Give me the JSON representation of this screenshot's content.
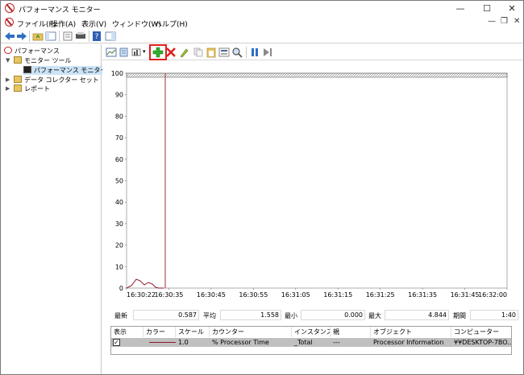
{
  "window": {
    "title": "パフォーマンス モニター",
    "minimize": "—",
    "maximize": "☐",
    "close": "✕"
  },
  "menu": {
    "items": [
      "ファイル(F)",
      "操作(A)",
      "表示(V)",
      "ウィンドウ(W)",
      "ヘルプ(H)"
    ],
    "mdi_minimize": "—",
    "mdi_restore": "❐",
    "mdi_close": "✕"
  },
  "tree": {
    "root": "パフォーマンス",
    "monitor_tools": "モニター ツール",
    "performance_monitor": "パフォーマンス モニター",
    "data_collector_sets": "データ コレクター セット",
    "reports": "レポート"
  },
  "graph": {
    "y_ticks": [
      "100",
      "90",
      "80",
      "70",
      "60",
      "50",
      "40",
      "30",
      "20",
      "10",
      "0"
    ],
    "x_ticks": [
      "16:30:22",
      "16:30:35",
      "16:30:45",
      "16:30:55",
      "16:31:05",
      "16:31:15",
      "16:31:25",
      "16:31:35",
      "16:31:45",
      "16:32:00"
    ]
  },
  "stats": {
    "last_label": "最新",
    "last_value": "0.587",
    "avg_label": "平均",
    "avg_value": "1.558",
    "min_label": "最小",
    "min_value": "0.000",
    "max_label": "最大",
    "max_value": "4.844",
    "duration_label": "期間",
    "duration_value": "1:40"
  },
  "table": {
    "headers": {
      "show": "表示",
      "color": "カラー",
      "scale": "スケール",
      "counter": "カウンター",
      "instance": "インスタンス",
      "parent": "親",
      "object": "オブジェクト",
      "computer": "コンピューター"
    },
    "row": {
      "checked": "✓",
      "scale": "1.0",
      "counter": "% Processor Time",
      "instance": "_Total",
      "parent": "---",
      "object": "Processor Information",
      "computer": "¥¥DESKTOP-7BO..."
    }
  },
  "colors": {
    "series": "#8b1a2a",
    "highlight": "#e0201e"
  }
}
